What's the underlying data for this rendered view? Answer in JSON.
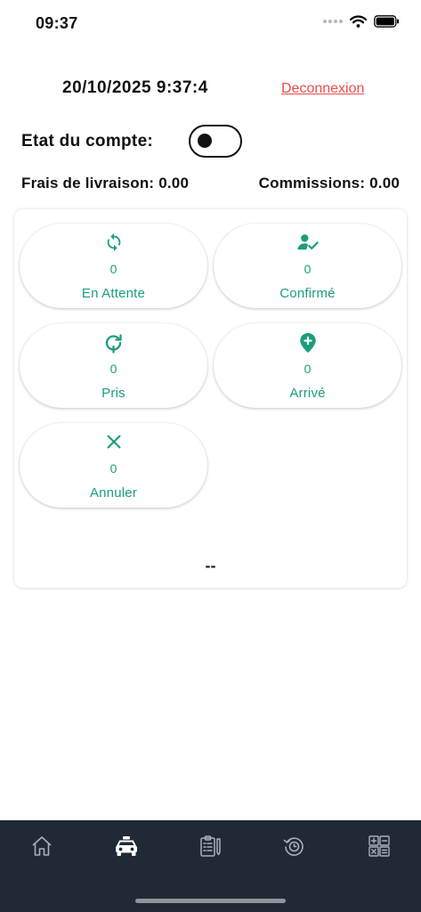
{
  "status_bar": {
    "time": "09:37"
  },
  "header": {
    "datetime": "20/10/2025 9:37:4",
    "logout_label": "Deconnexion"
  },
  "account": {
    "label": "Etat du compte:",
    "active": false
  },
  "summary": {
    "delivery_fees": "Frais de livraison: 0.00",
    "commissions": "Commissions: 0.00"
  },
  "status_tiles": [
    {
      "label": "En Attente",
      "count": "0",
      "icon": "sync-icon"
    },
    {
      "label": "Confirmé",
      "count": "0",
      "icon": "user-check-icon"
    },
    {
      "label": "Pris",
      "count": "0",
      "icon": "refresh-location-icon"
    },
    {
      "label": "Arrivé",
      "count": "0",
      "icon": "map-pin-plus-icon"
    },
    {
      "label": "Annuler",
      "count": "0",
      "icon": "close-icon"
    }
  ],
  "card_footer": "--",
  "bottom_nav": [
    {
      "icon": "home-icon",
      "active": false
    },
    {
      "icon": "taxi-icon",
      "active": true
    },
    {
      "icon": "clipboard-icon",
      "active": false
    },
    {
      "icon": "history-icon",
      "active": false
    },
    {
      "icon": "calculator-icon",
      "active": false
    }
  ],
  "colors": {
    "accent": "#1a9e7c",
    "logout": "#ee4b4b",
    "nav_bg": "#1f2a36",
    "nav_icon": "#a9b0b8",
    "nav_icon_active": "#ffffff"
  }
}
